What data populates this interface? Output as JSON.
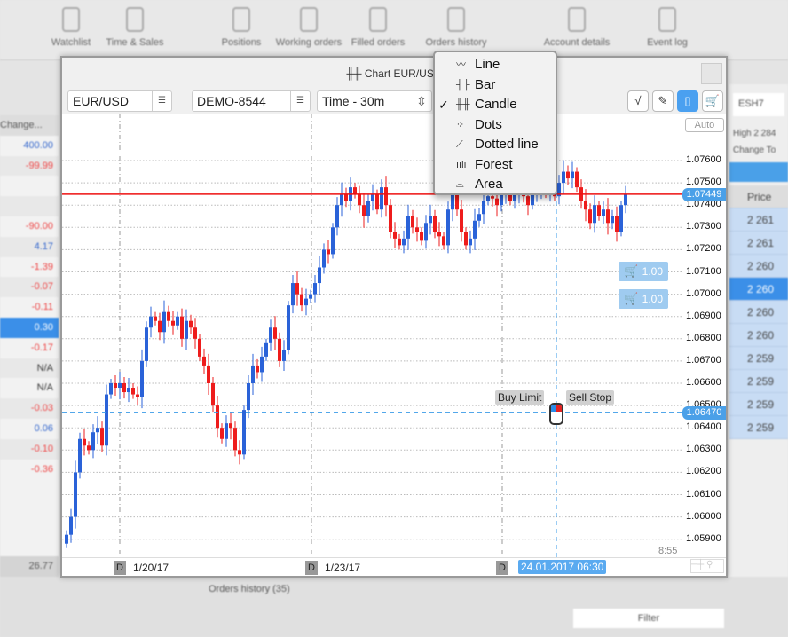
{
  "background": {
    "toolbar": [
      "Watchlist",
      "Time & Sales",
      "Positions",
      "Working orders",
      "Filled orders",
      "Orders history",
      "Account details",
      "Event log"
    ],
    "left_header": "Change...",
    "left_values": [
      "400.00",
      "-99.99",
      "",
      "",
      "-90.00",
      "4.17",
      "-1.39",
      "-0.07",
      "-0.11",
      "0.30",
      "-0.17",
      "N/A",
      "N/A",
      "-0.03",
      "0.06",
      "-0.10",
      "-0.36"
    ],
    "left_footer": "26.77",
    "right": {
      "symbol": "ESH7",
      "high": "High 2 284",
      "change": "Change To",
      "price_header": "Price",
      "prices": [
        "2 261",
        "2 261",
        "2 260",
        "2 260",
        "2 260",
        "2 260",
        "2 259",
        "2 259",
        "2 259",
        "2 259"
      ]
    },
    "bottom_tab": "Orders history (35)",
    "filter": "Filter"
  },
  "window": {
    "title": "Chart EUR/USD",
    "symbol": "EUR/USD",
    "account": "DEMO-8544",
    "timeframe": "Time - 30m",
    "auto_label": "Auto",
    "time_label": "8:55"
  },
  "chart_type_menu": {
    "items": [
      {
        "label": "Line",
        "icon": "〰",
        "checked": false
      },
      {
        "label": "Bar",
        "icon": "┤├",
        "checked": false
      },
      {
        "label": "Candle",
        "icon": "╫╫",
        "checked": true
      },
      {
        "label": "Dots",
        "icon": "⁘",
        "checked": false
      },
      {
        "label": "Dotted line",
        "icon": "⟋",
        "checked": false
      },
      {
        "label": "Forest",
        "icon": "ıılı",
        "checked": false
      },
      {
        "label": "Area",
        "icon": "⌓",
        "checked": false
      }
    ],
    "check_mark": "✓"
  },
  "order_markers": {
    "buy_limit": "Buy Limit",
    "sell_stop": "Sell Stop",
    "cart_qty": [
      "1.00",
      "1.00"
    ]
  },
  "chart_data": {
    "type": "candlestick",
    "symbol": "EUR/USD",
    "interval": "30m",
    "ylim": [
      1.0585,
      1.078
    ],
    "yticks": [
      "1.07600",
      "1.07500",
      "1.07400",
      "1.07300",
      "1.07200",
      "1.07100",
      "1.07000",
      "1.06900",
      "1.06800",
      "1.06700",
      "1.06600",
      "1.06500",
      "1.06400",
      "1.06300",
      "1.06200",
      "1.06100",
      "1.06000",
      "1.05900"
    ],
    "current_price": "1.07449",
    "cursor_price": "1.06470",
    "cursor_time": "24.01.2017 06:30",
    "date_marks": [
      {
        "badge": "D",
        "label": "1/20/17"
      },
      {
        "badge": "D",
        "label": "1/23/17"
      },
      {
        "badge": "D",
        "label": ""
      }
    ],
    "up_color": "#2a62d8",
    "down_color": "#ee1c1c",
    "closes": [
      1.0592,
      1.06,
      1.062,
      1.0635,
      1.0632,
      1.063,
      1.0638,
      1.064,
      1.0632,
      1.0655,
      1.066,
      1.0658,
      1.066,
      1.0656,
      1.0658,
      1.0655,
      1.0654,
      1.067,
      1.0685,
      1.069,
      1.0688,
      1.0683,
      1.0692,
      1.0688,
      1.0686,
      1.069,
      1.068,
      1.0688,
      1.0685,
      1.068,
      1.0672,
      1.0668,
      1.066,
      1.065,
      1.064,
      1.0635,
      1.0642,
      1.064,
      1.063,
      1.0628,
      1.0648,
      1.066,
      1.0668,
      1.0665,
      1.0672,
      1.0678,
      1.0685,
      1.068,
      1.067,
      1.0675,
      1.0695,
      1.0705,
      1.07,
      1.0695,
      1.0698,
      1.07,
      1.0705,
      1.0712,
      1.072,
      1.0718,
      1.073,
      1.074,
      1.0745,
      1.0742,
      1.0748,
      1.0745,
      1.074,
      1.0735,
      1.0742,
      1.0745,
      1.0738,
      1.0748,
      1.074,
      1.0728,
      1.0725,
      1.0722,
      1.0725,
      1.0735,
      1.073,
      1.0728,
      1.0724,
      1.0732,
      1.0735,
      1.0728,
      1.0726,
      1.0722,
      1.0738,
      1.0745,
      1.0738,
      1.0728,
      1.0722,
      1.0725,
      1.0733,
      1.0736,
      1.0742,
      1.0744,
      1.0743,
      1.074,
      1.0745,
      1.0748,
      1.0742,
      1.0746,
      1.075,
      1.0744,
      1.074,
      1.0745,
      1.0748,
      1.0752,
      1.0746,
      1.0748,
      1.0744,
      1.075,
      1.0755,
      1.0752,
      1.0755,
      1.0748,
      1.0742,
      1.0738,
      1.0732,
      1.074,
      1.0735,
      1.0738,
      1.0732,
      1.0735,
      1.0728,
      1.074,
      1.0745
    ]
  }
}
